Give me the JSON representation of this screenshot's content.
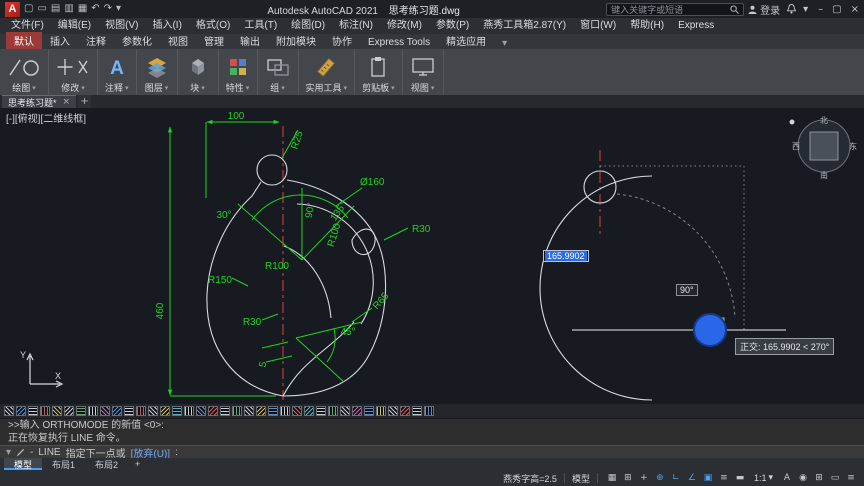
{
  "titlebar": {
    "logo_letter": "A",
    "quick_access": [
      {
        "name": "new-file-icon",
        "glyph": "▢"
      },
      {
        "name": "open-icon",
        "glyph": "▭"
      },
      {
        "name": "save-icon",
        "glyph": "▤"
      },
      {
        "name": "save-as-icon",
        "glyph": "▥"
      },
      {
        "name": "plot-icon",
        "glyph": "▦"
      },
      {
        "name": "undo-icon",
        "glyph": "↶"
      },
      {
        "name": "redo-icon",
        "glyph": "↷"
      },
      {
        "name": "quick-access-dropdown-icon",
        "glyph": "▾"
      }
    ],
    "app_title": "Autodesk AutoCAD 2021",
    "doc_title": "思考练习题.dwg",
    "search_placeholder": "键入关键字或短语",
    "signin_label": "登录",
    "menu_dropdown_glyph": "▾",
    "window_buttons": {
      "minimize": "–",
      "maximize": "▢",
      "close": "×"
    }
  },
  "menubar": {
    "items": [
      "文件(F)",
      "编辑(E)",
      "视图(V)",
      "插入(I)",
      "格式(O)",
      "工具(T)",
      "绘图(D)",
      "标注(N)",
      "修改(M)",
      "参数(P)",
      "燕秀工具箱2.87(Y)",
      "窗口(W)",
      "帮助(H)",
      "Express"
    ]
  },
  "ribbon": {
    "tabs": [
      {
        "label": "默认",
        "active": true
      },
      {
        "label": "插入"
      },
      {
        "label": "注释"
      },
      {
        "label": "参数化"
      },
      {
        "label": "视图"
      },
      {
        "label": "管理"
      },
      {
        "label": "输出"
      },
      {
        "label": "附加模块"
      },
      {
        "label": "协作"
      },
      {
        "label": "Express Tools"
      },
      {
        "label": "精选应用"
      }
    ],
    "collapse_glyph": "▾",
    "panel_dropdown_glyph": "▾",
    "panels": [
      {
        "label": "绘图"
      },
      {
        "label": "修改"
      },
      {
        "label": "注释",
        "icon_glyph": "A"
      },
      {
        "label": "图层"
      },
      {
        "label": "块"
      },
      {
        "label": "特性"
      },
      {
        "label": "组"
      },
      {
        "label": "实用工具"
      },
      {
        "label": "剪贴板"
      },
      {
        "label": "视图"
      }
    ]
  },
  "filetabs": {
    "tabs": [
      {
        "label": "思考练习题*",
        "close": "×",
        "active": true
      }
    ],
    "new_tab": "+"
  },
  "canvas": {
    "viewport_label": "[-][俯视][二维线框]",
    "viewcube": {
      "north": "北",
      "south": "南",
      "east": "东",
      "west": "西"
    },
    "ucs": {
      "x": "X",
      "y": "Y"
    },
    "dims": [
      "100",
      "R25",
      "Ø160",
      "90°",
      "135°",
      "R30",
      "30°",
      "R100",
      "R100",
      "R150",
      "R65",
      "R30",
      "45°",
      "5",
      "460"
    ],
    "dynamic_input": "165.9902",
    "angle_badge": "90°",
    "tooltip": "正交: 165.9902 < 270°",
    "dimension_color": "#1fd41f",
    "centerline_color": "#e03f3f",
    "geometry_color": "#d6dbe0",
    "cursor_marker_color": "#2a66e8"
  },
  "hatch_bar": {
    "swatches": [
      "#c9ced4",
      "#5a8fd6",
      "#c9ced4",
      "#d65a5a",
      "#d6c05a",
      "#c9ced4",
      "#5ab06a",
      "#c9ced4",
      "#c06ab8",
      "#5a8fd6",
      "#c9ced4",
      "#d65a5a",
      "#c9ced4",
      "#d6c05a",
      "#52b8c8",
      "#c9ced4",
      "#5a8fd6",
      "#d65a5a",
      "#c9ced4",
      "#5ab06a",
      "#c9ced4",
      "#d6c05a",
      "#5a8fd6",
      "#c9ced4",
      "#d65a5a",
      "#52b8c8",
      "#c9ced4",
      "#5ab06a",
      "#c9ced4",
      "#c06ab8",
      "#5a8fd6",
      "#d6c05a",
      "#c9ced4",
      "#d65a5a",
      "#c9ced4",
      "#5a8fd6"
    ]
  },
  "commandline": {
    "history": [
      ">>输入 ORTHOMODE 的新值 <0>:",
      "正在恢复执行 LINE 命令。"
    ],
    "history_toggle_glyph": "▾",
    "prompt_dash": "-",
    "prompt_command": "LINE",
    "prompt_text": "指定下一点或",
    "prompt_option": "[放弃(U)]",
    "prompt_suffix": ":"
  },
  "layout_tabs": {
    "tabs": [
      {
        "label": "模型",
        "active": true
      },
      {
        "label": "布局1"
      },
      {
        "label": "布局2"
      }
    ],
    "add": "+"
  },
  "statusbar": {
    "custom_text": "燕秀字高=2.5",
    "model_label": "模型",
    "icons_left": [
      {
        "name": "grid-icon",
        "glyph": "▦",
        "active": false
      },
      {
        "name": "snap-mode-icon",
        "glyph": "⊞",
        "active": false
      },
      {
        "name": "infer-constraints-icon",
        "glyph": "+",
        "active": false
      },
      {
        "name": "dynamic-input-icon",
        "glyph": "⊕",
        "active": true
      },
      {
        "name": "ortho-mode-icon",
        "glyph": "∟",
        "active": true
      },
      {
        "name": "polar-tracking-icon",
        "glyph": "∠",
        "active": true
      },
      {
        "name": "object-snap-icon",
        "glyph": "▣",
        "active": true
      },
      {
        "name": "object-snap-tracking-icon",
        "glyph": "≡",
        "active": false
      },
      {
        "name": "lineweight-icon",
        "glyph": "▬",
        "active": false
      }
    ],
    "scale_label": "1:1",
    "scale_dropdown": "▾",
    "icons_right": [
      {
        "name": "annotation-visibility-icon",
        "glyph": "A",
        "active": false
      },
      {
        "name": "workspace-switching-icon",
        "glyph": "◉",
        "active": false
      },
      {
        "name": "annotation-monitor-icon",
        "glyph": "⊞",
        "active": false
      },
      {
        "name": "clean-screen-icon",
        "glyph": "▭",
        "active": false
      },
      {
        "name": "customize-icon",
        "glyph": "≡",
        "active": false
      }
    ]
  }
}
